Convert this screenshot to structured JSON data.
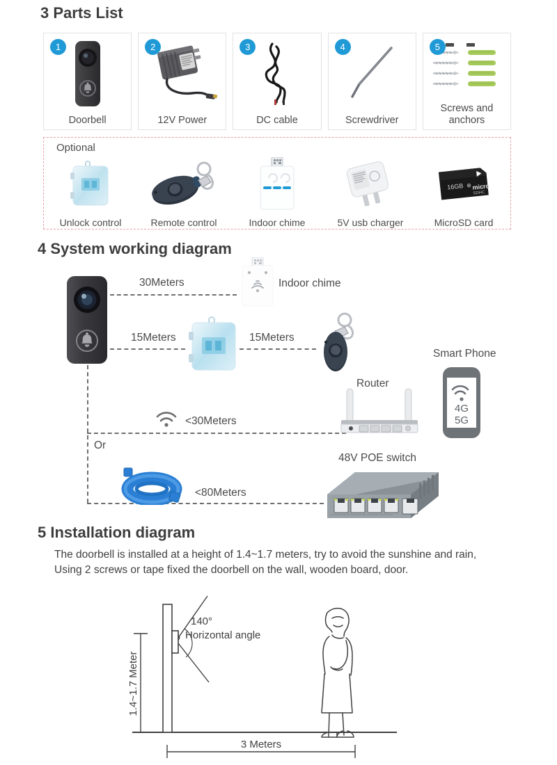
{
  "sections": {
    "parts": {
      "number": "3",
      "title": "Parts List"
    },
    "system": {
      "number": "4",
      "title": "System working diagram"
    },
    "install": {
      "number": "5",
      "title": "Installation diagram"
    }
  },
  "parts_list": {
    "items": [
      {
        "badge": "1",
        "label": "Doorbell",
        "icon": "doorbell-icon"
      },
      {
        "badge": "2",
        "label": "12V Power",
        "icon": "power-adapter-icon"
      },
      {
        "badge": "3",
        "label": "DC cable",
        "icon": "dc-cable-icon"
      },
      {
        "badge": "4",
        "label": "Screwdriver",
        "icon": "screwdriver-icon"
      },
      {
        "badge": "5",
        "label": "Screws and anchors",
        "icon": "screws-anchors-icon"
      }
    ],
    "badge_color": "#1f9ad6",
    "card_border_color": "#e2e2e2"
  },
  "optional": {
    "heading": "Optional",
    "border_color": "#e8a0a8",
    "items": [
      {
        "label": "Unlock control",
        "icon": "unlock-control-icon"
      },
      {
        "label": "Remote control",
        "icon": "remote-control-icon"
      },
      {
        "label": "Indoor chime",
        "icon": "indoor-chime-icon"
      },
      {
        "label": "5V usb charger",
        "icon": "usb-charger-icon"
      },
      {
        "label": "MicroSD card",
        "icon": "microsd-card-icon"
      }
    ]
  },
  "system_diagram": {
    "labels": {
      "chime_distance": "30Meters",
      "unlock_distance": "15Meters",
      "remote_distance": "15Meters",
      "indoor_chime": "Indoor chime",
      "smart_phone": "Smart Phone",
      "router": "Router",
      "wifi_distance": "<30Meters",
      "or": "Or",
      "lan_distance": "<80Meters",
      "poe_switch": "48V POE switch",
      "phone_net_4g": "4G",
      "phone_net_5g": "5G"
    }
  },
  "installation": {
    "description": "The doorbell is installed at a height of 1.4~1.7 meters, try to avoid the sunshine and rain, Using 2 screws or tape fixed the doorbell on the wall, wooden board, door.",
    "diagram": {
      "angle": "140°",
      "angle_caption": "Horizontal angle",
      "height_label": "1.4~1.7 Meter",
      "distance_label": "3 Meters"
    }
  },
  "colors": {
    "accent_blue": "#1f9ad6",
    "anchor_green": "#a5c95a",
    "cable_blue": "#2a7fd4",
    "text": "#3f3f3f",
    "dash_gray": "#6e6e6e"
  }
}
